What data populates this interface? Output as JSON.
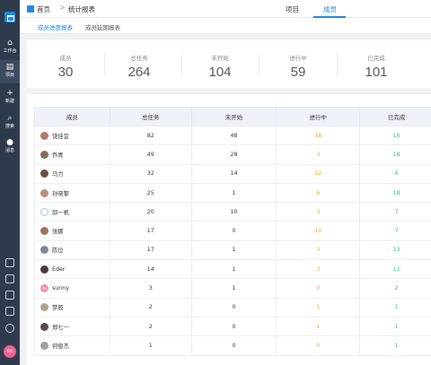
{
  "sidebar": {
    "items": [
      {
        "icon": "home-icon",
        "label": "工作台"
      },
      {
        "icon": "project-icon",
        "label": "项目"
      },
      {
        "icon": "plus-icon",
        "label": "新建"
      },
      {
        "icon": "search-icon",
        "label": "搜索"
      },
      {
        "icon": "message-icon",
        "label": "消息"
      }
    ],
    "user_avatar": "su"
  },
  "header": {
    "crumb_home": "首页",
    "crumb_separator": ">",
    "crumb_current": "统计报表",
    "tabs": [
      "项目",
      "成员"
    ],
    "active_tab": "成员"
  },
  "subtabs": [
    "成员进度报表",
    "成员延期报表"
  ],
  "stats": {
    "members_label": "成员",
    "members_value": "30",
    "total_label": "总任务",
    "total_value": "264",
    "notstarted_label": "未开始",
    "notstarted_value": "104",
    "inprogress_label": "进行中",
    "inprogress_value": "59",
    "done_label": "已完成",
    "done_value": "101"
  },
  "colors": {
    "accent": "#1e88e5",
    "inprogress": "#f5a623",
    "done": "#2ec27e"
  },
  "table": {
    "headers": [
      "成员",
      "总任务",
      "未开始",
      "进行中",
      "已完成"
    ],
    "rows": [
      {
        "name": "饶佳宜",
        "total": "82",
        "notstarted": "48",
        "inprogress": "18",
        "done": "16"
      },
      {
        "name": "乔青",
        "total": "49",
        "notstarted": "28",
        "inprogress": "3",
        "done": "18"
      },
      {
        "name": "马力",
        "total": "32",
        "notstarted": "14",
        "inprogress": "12",
        "done": "6"
      },
      {
        "name": "孙晓黎",
        "total": "25",
        "notstarted": "1",
        "inprogress": "6",
        "done": "18"
      },
      {
        "name": "邱一帆",
        "total": "20",
        "notstarted": "10",
        "inprogress": "3",
        "done": "7"
      },
      {
        "name": "张娜",
        "total": "17",
        "notstarted": "0",
        "inprogress": "10",
        "done": "7"
      },
      {
        "name": "陈位",
        "total": "17",
        "notstarted": "1",
        "inprogress": "3",
        "done": "13"
      },
      {
        "name": "Eder",
        "total": "14",
        "notstarted": "1",
        "inprogress": "3",
        "done": "11"
      },
      {
        "name": "sunny",
        "avatar_text": "su",
        "total": "3",
        "notstarted": "1",
        "inprogress": "0",
        "done": "2"
      },
      {
        "name": "梦辰",
        "total": "2",
        "notstarted": "0",
        "inprogress": "1",
        "done": "1"
      },
      {
        "name": "郑七一",
        "total": "2",
        "notstarted": "0",
        "inprogress": "1",
        "done": "1"
      },
      {
        "name": "何俊杰",
        "total": "1",
        "notstarted": "0",
        "inprogress": "0",
        "done": "1"
      }
    ]
  }
}
